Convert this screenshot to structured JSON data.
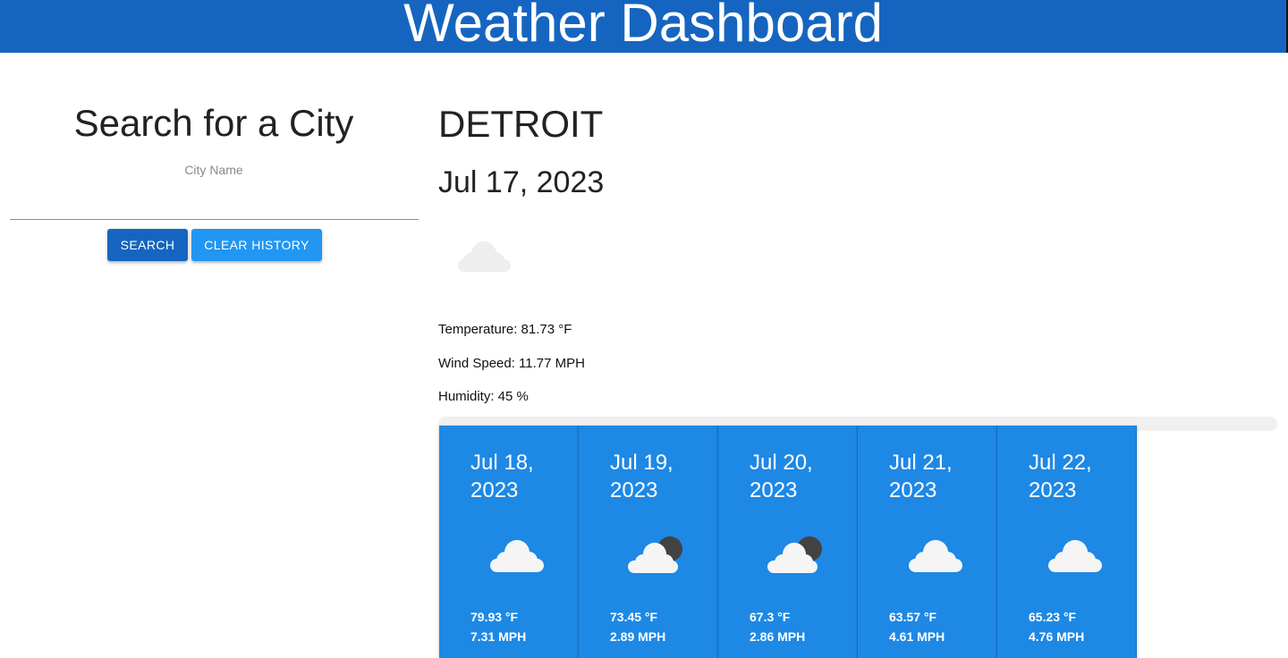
{
  "header": {
    "title": "Weather Dashboard"
  },
  "search": {
    "title": "Search for a City",
    "label": "City Name",
    "input_value": "",
    "search_label": "SEARCH",
    "clear_label": "CLEAR HISTORY"
  },
  "current": {
    "city": "DETROIT",
    "date": "Jul 17, 2023",
    "icon": "cloud-icon",
    "temperature": "Temperature: 81.73 °F",
    "wind": "Wind Speed: 11.77 MPH",
    "humidity": "Humidity: 45 %"
  },
  "forecast": [
    {
      "date": "Jul 18, 2023",
      "icon": "cloud-icon",
      "temp": "79.93 °F",
      "wind": "7.31 MPH"
    },
    {
      "date": "Jul 19, 2023",
      "icon": "cloud-night-icon",
      "temp": "73.45 °F",
      "wind": "2.89 MPH"
    },
    {
      "date": "Jul 20, 2023",
      "icon": "cloud-night-icon",
      "temp": "67.3 °F",
      "wind": "2.86 MPH"
    },
    {
      "date": "Jul 21, 2023",
      "icon": "cloud-icon",
      "temp": "63.57 °F",
      "wind": "4.61 MPH"
    },
    {
      "date": "Jul 22, 2023",
      "icon": "cloud-icon",
      "temp": "65.23 °F",
      "wind": "4.76 MPH"
    }
  ],
  "colors": {
    "header": "#1565c0",
    "search_button": "#1565c0",
    "clear_button": "#2196f3",
    "card": "#1e88e5"
  }
}
